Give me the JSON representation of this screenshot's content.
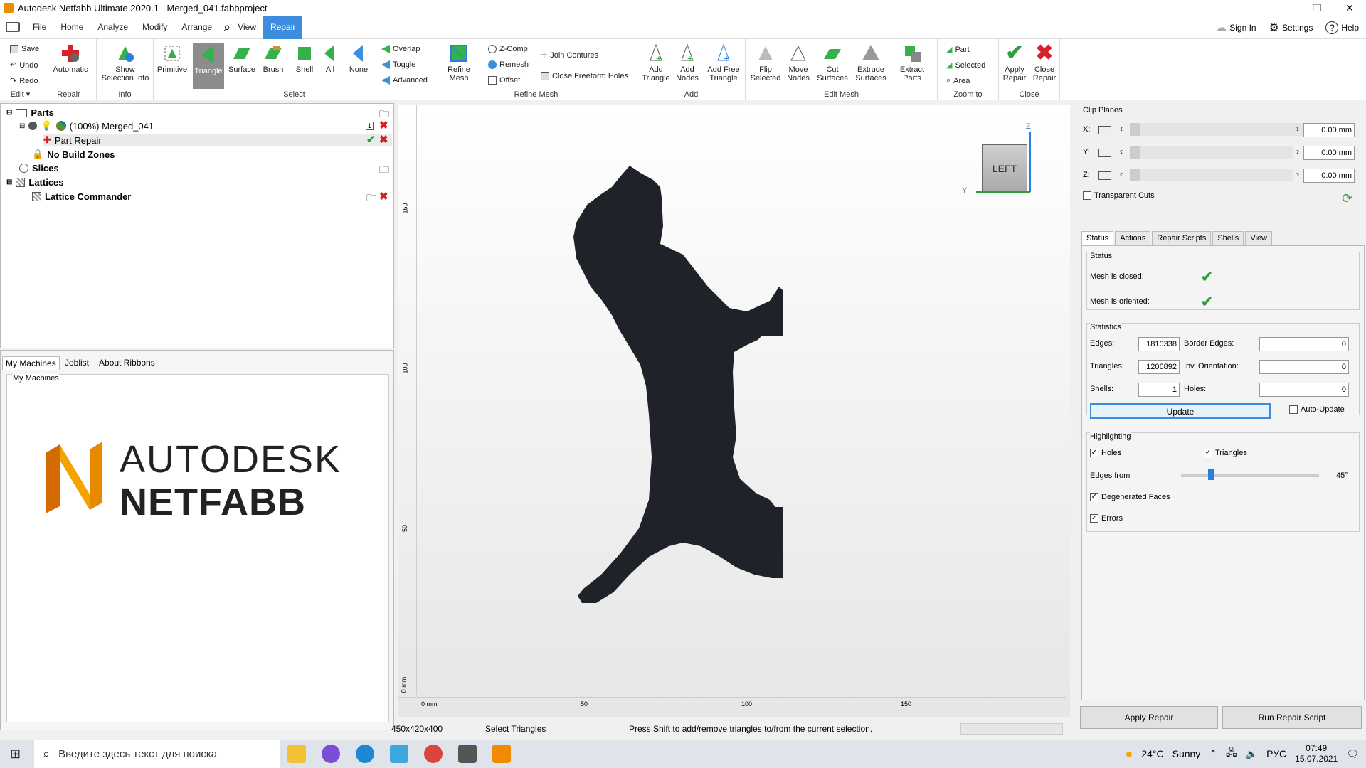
{
  "window": {
    "title": "Autodesk Netfabb Ultimate 2020.1 - Merged_041.fabbproject",
    "min": "–",
    "max": "❐",
    "close": "✕"
  },
  "menu": {
    "items": [
      "File",
      "Home",
      "Analyze",
      "Modify",
      "Arrange",
      "View",
      "Repair"
    ],
    "active": "Repair",
    "sign_in": "Sign In",
    "settings": "Settings",
    "help": "Help"
  },
  "ribbon": {
    "edit": {
      "save": "Save",
      "undo": "Undo",
      "redo": "Redo",
      "label": "Edit ▾"
    },
    "repair": {
      "automatic": "Automatic",
      "label": "Repair"
    },
    "info": {
      "show_selection_info": "Show Selection Info",
      "label": "Info"
    },
    "select": {
      "primitive": "Primitive",
      "triangle": "Triangle",
      "surface": "Surface",
      "brush": "Brush",
      "shell": "Shell",
      "all": "All",
      "none": "None",
      "overlap": "Overlap",
      "toggle": "Toggle",
      "advanced": "Advanced",
      "label": "Select"
    },
    "refine": {
      "refine_mesh": "Refine Mesh",
      "zcomp": "Z-Comp",
      "remesh": "Remesh",
      "offset": "Offset",
      "join_contures": "Join Contures",
      "close_freeform_holes": "Close Freeform Holes",
      "label": "Refine Mesh"
    },
    "add": {
      "add_triangle": "Add Triangle",
      "add_nodes": "Add Nodes",
      "add_free_triangle": "Add Free Triangle",
      "label": "Add"
    },
    "edit_mesh": {
      "flip_selected": "Flip Selected",
      "move_nodes": "Move Nodes",
      "cut_surfaces": "Cut Surfaces",
      "extrude_surfaces": "Extrude Surfaces",
      "extract_parts": "Extract Parts",
      "label": "Edit Mesh"
    },
    "zoom": {
      "part": "Part",
      "selected": "Selected",
      "area": "Area",
      "label": "Zoom to"
    },
    "close": {
      "apply_repair": "Apply Repair",
      "close_repair": "Close Repair",
      "label": "Close"
    }
  },
  "tree": {
    "parts": "Parts",
    "merged": "(100%) Merged_041",
    "part_repair": "Part Repair",
    "no_build_zones": "No Build Zones",
    "slices": "Slices",
    "lattices": "Lattices",
    "lattice_commander": "Lattice Commander",
    "badge": "1"
  },
  "lower_tabs": [
    "My Machines",
    "Joblist",
    "About Ribbons"
  ],
  "machines": {
    "title": "My Machines",
    "logo_line1": "AUTODESK",
    "logo_line2": "NETFABB"
  },
  "viewport": {
    "view_cube": "LEFT",
    "axis_z": "Z",
    "axis_y": "Y",
    "ruler_h": [
      "0 mm",
      "50",
      "100",
      "150"
    ],
    "ruler_v": [
      "150",
      "100",
      "50",
      "0 mm"
    ]
  },
  "status": {
    "dims": "450x420x400",
    "mode": "Select Triangles",
    "hint": "Press Shift to add/remove triangles to/from the current selection."
  },
  "clip": {
    "title": "Clip Planes",
    "x_label": "X:",
    "y_label": "Y:",
    "z_label": "Z:",
    "x": "0.00 mm",
    "y": "0.00 mm",
    "z": "0.00 mm",
    "transparent_cuts": "Transparent Cuts"
  },
  "right_tabs": [
    "Status",
    "Actions",
    "Repair Scripts",
    "Shells",
    "View"
  ],
  "status_panel": {
    "status_title": "Status",
    "mesh_closed": "Mesh is closed:",
    "mesh_oriented": "Mesh is oriented:",
    "statistics": "Statistics",
    "edges_label": "Edges:",
    "edges": "1810338",
    "triangles_label": "Triangles:",
    "triangles": "1206892",
    "shells_label": "Shells:",
    "shells": "1",
    "border_edges_label": "Border Edges:",
    "border_edges": "0",
    "inv_orientation_label": "Inv. Orientation:",
    "inv_orientation": "0",
    "holes_label": "Holes:",
    "holes": "0",
    "update": "Update",
    "auto_update": "Auto-Update",
    "highlighting": "Highlighting",
    "hl_holes": "Holes",
    "hl_triangles": "Triangles",
    "edges_from": "Edges from",
    "edges_from_value": "45°",
    "degenerated_faces": "Degenerated Faces",
    "errors": "Errors"
  },
  "bottom_buttons": {
    "apply_repair": "Apply Repair",
    "run_repair_script": "Run Repair Script"
  },
  "taskbar": {
    "search_placeholder": "Введите здесь текст для поиска",
    "temp": "24°C",
    "weather": "Sunny",
    "lang": "РУС",
    "time": "07:49",
    "date": "15.07.2021"
  },
  "colors": {
    "accent": "#3c8dde",
    "check_green": "#2e9e3e",
    "red_x": "#d9202a",
    "mesh": "#1f2329"
  }
}
